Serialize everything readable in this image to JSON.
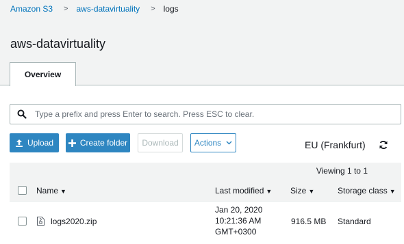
{
  "breadcrumb": {
    "items": [
      "Amazon S3",
      "aws-datavirtuality"
    ],
    "current": "logs",
    "separator": ">"
  },
  "bucket": {
    "title": "aws-datavirtuality"
  },
  "tabs": [
    {
      "label": "Overview",
      "active": true
    }
  ],
  "search": {
    "placeholder": "Type a prefix and press Enter to search. Press ESC to clear."
  },
  "toolbar": {
    "upload_label": "Upload",
    "create_folder_label": "Create folder",
    "download_label": "Download",
    "actions_label": "Actions"
  },
  "region": {
    "label": "EU (Frankfurt)"
  },
  "pagination": {
    "viewing": "Viewing 1 to 1"
  },
  "table": {
    "columns": [
      "Name",
      "Last modified",
      "Size",
      "Storage class"
    ],
    "rows": [
      {
        "name": "logs2020.zip",
        "modified_date": "Jan 20, 2020",
        "modified_time": "10:21:36 AM",
        "modified_tz": "GMT+0300",
        "size": "916.5 MB",
        "storage_class": "Standard"
      }
    ]
  },
  "colors": {
    "accent": "#2e86c1",
    "link": "#0073bb",
    "header_bg": "#f2f3f3",
    "border": "#aab7b8"
  },
  "icons": [
    "search-icon",
    "upload-icon",
    "plus-icon",
    "chevron-down-icon",
    "refresh-icon",
    "file-zip-icon",
    "sort-caret-icon"
  ]
}
